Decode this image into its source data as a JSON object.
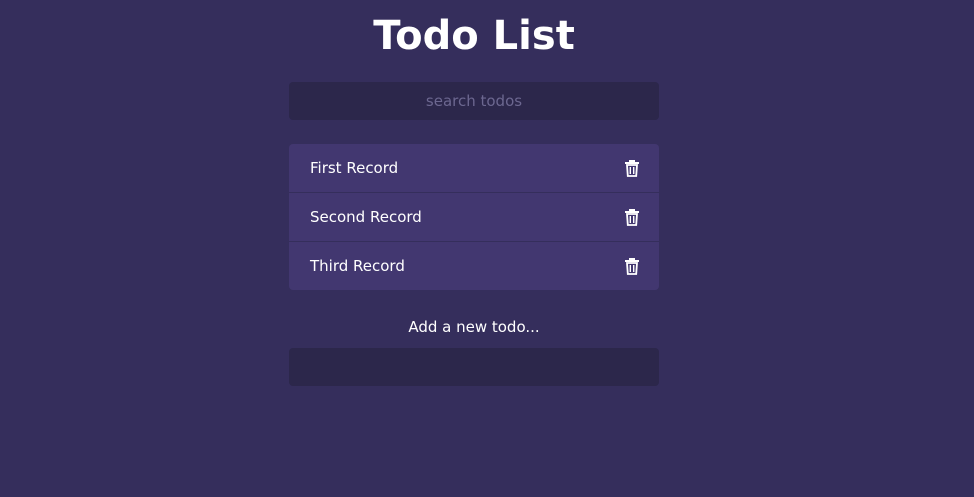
{
  "page": {
    "title": "Todo List"
  },
  "search": {
    "placeholder": "search todos",
    "value": ""
  },
  "todos": [
    {
      "label": "First Record",
      "icon": "trash-icon"
    },
    {
      "label": "Second Record",
      "icon": "trash-icon"
    },
    {
      "label": "Third Record",
      "icon": "trash-icon"
    }
  ],
  "add": {
    "label": "Add a new todo...",
    "value": ""
  },
  "colors": {
    "background": "#352e5c",
    "input_background": "#2c274b",
    "item_background": "#423770",
    "text": "#ffffff"
  }
}
